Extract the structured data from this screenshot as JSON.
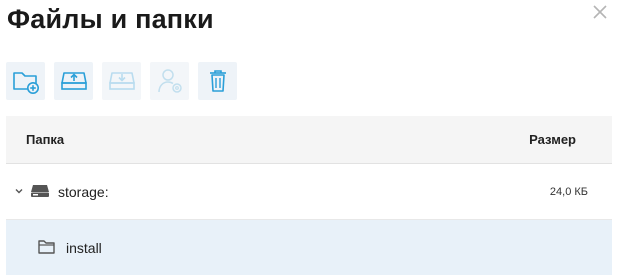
{
  "dialog": {
    "title": "Файлы и папки",
    "close_icon": "close-icon"
  },
  "toolbar": {
    "buttons": [
      {
        "name": "new-folder",
        "icon": "folder-plus-icon",
        "enabled": true
      },
      {
        "name": "upload",
        "icon": "upload-drive-icon",
        "enabled": true
      },
      {
        "name": "download",
        "icon": "download-drive-icon",
        "enabled": false
      },
      {
        "name": "permissions",
        "icon": "user-settings-icon",
        "enabled": false
      },
      {
        "name": "delete",
        "icon": "trash-icon",
        "enabled": true
      }
    ],
    "accent_color": "#2a9fd8",
    "disabled_color": "#b9dcef"
  },
  "table": {
    "columns": {
      "name": "Папка",
      "size": "Размер"
    },
    "rows": [
      {
        "label": "storage:",
        "size": "24,0 КБ",
        "type": "drive",
        "expanded": true
      },
      {
        "label": "install",
        "size": "",
        "type": "folder",
        "selected": true
      }
    ]
  }
}
